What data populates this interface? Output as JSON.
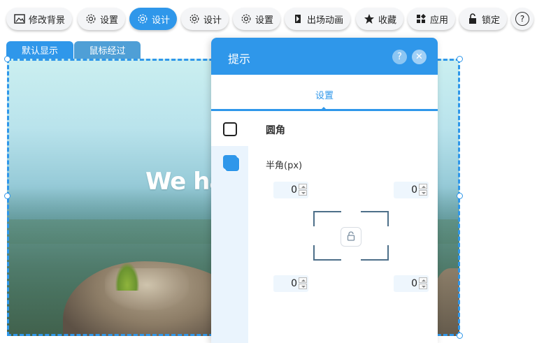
{
  "toolbar": {
    "buttons": [
      {
        "label": "修改背景",
        "icon": "image-icon"
      },
      {
        "label": "设置",
        "icon": "gear-icon"
      },
      {
        "label": "设计",
        "icon": "gear-icon",
        "active": true
      },
      {
        "label": "设计",
        "icon": "gear-icon"
      },
      {
        "label": "设置",
        "icon": "gear-icon"
      },
      {
        "label": "出场动画",
        "icon": "animation-icon"
      },
      {
        "label": "收藏",
        "icon": "star-icon"
      },
      {
        "label": "应用",
        "icon": "apps-icon"
      },
      {
        "label": "锁定",
        "icon": "lock-open-icon"
      }
    ],
    "help_icon": "?"
  },
  "canvas_tabs": [
    "默认显示",
    "鼠标经过"
  ],
  "canvas": {
    "headline": "We hav"
  },
  "dialog": {
    "title": "提示",
    "help_symbol": "?",
    "close_symbol": "✕",
    "tab_label": "设置",
    "section_title": "圆角",
    "field_label": "半角(px)",
    "radius": {
      "top_left": "0",
      "top_right": "0",
      "bottom_left": "0",
      "bottom_right": "0"
    }
  },
  "colors": {
    "accent": "#2f97ea",
    "panel_side": "#eaf4fd"
  }
}
